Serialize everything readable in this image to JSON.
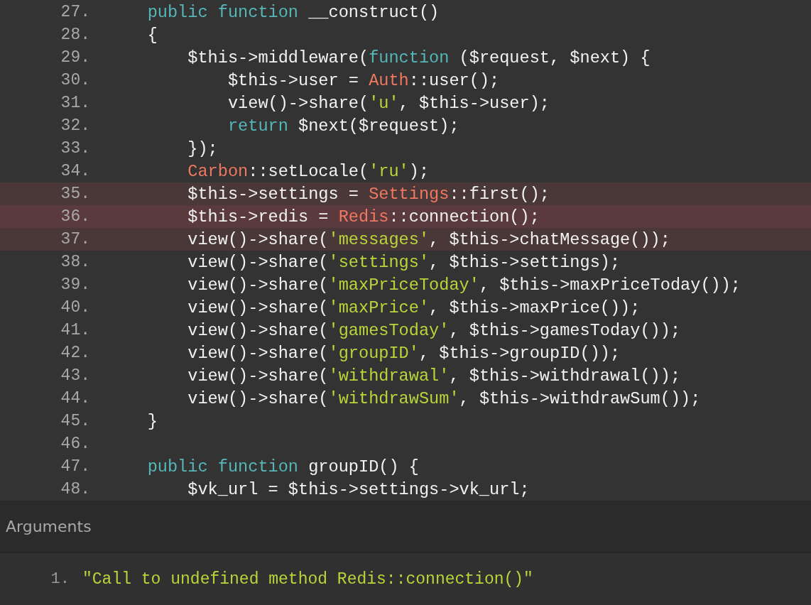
{
  "code_frame": {
    "lines": [
      {
        "number": "27.",
        "highlighted": false,
        "error": false,
        "tokens": [
          {
            "kind": "keyword",
            "text": "    public function"
          },
          {
            "kind": "plain",
            "text": " __construct()"
          }
        ]
      },
      {
        "number": "28.",
        "highlighted": false,
        "error": false,
        "tokens": [
          {
            "kind": "plain",
            "text": "    {"
          }
        ]
      },
      {
        "number": "29.",
        "highlighted": false,
        "error": false,
        "tokens": [
          {
            "kind": "plain",
            "text": "        $this->middleware("
          },
          {
            "kind": "keyword",
            "text": "function"
          },
          {
            "kind": "plain",
            "text": " ($request, $next) {"
          }
        ]
      },
      {
        "number": "30.",
        "highlighted": false,
        "error": false,
        "tokens": [
          {
            "kind": "plain",
            "text": "            $this->user = "
          },
          {
            "kind": "class",
            "text": "Auth"
          },
          {
            "kind": "plain",
            "text": "::user();"
          }
        ]
      },
      {
        "number": "31.",
        "highlighted": false,
        "error": false,
        "tokens": [
          {
            "kind": "plain",
            "text": "            view()->share("
          },
          {
            "kind": "string",
            "text": "'u'"
          },
          {
            "kind": "plain",
            "text": ", $this->user);"
          }
        ]
      },
      {
        "number": "32.",
        "highlighted": false,
        "error": false,
        "tokens": [
          {
            "kind": "keyword",
            "text": "            return"
          },
          {
            "kind": "plain",
            "text": " $next($request);"
          }
        ]
      },
      {
        "number": "33.",
        "highlighted": false,
        "error": false,
        "tokens": [
          {
            "kind": "plain",
            "text": "        });"
          }
        ]
      },
      {
        "number": "34.",
        "highlighted": false,
        "error": false,
        "tokens": [
          {
            "kind": "class",
            "text": "        Carbon"
          },
          {
            "kind": "plain",
            "text": "::setLocale("
          },
          {
            "kind": "string",
            "text": "'ru'"
          },
          {
            "kind": "plain",
            "text": ");"
          }
        ]
      },
      {
        "number": "35.",
        "highlighted": true,
        "error": false,
        "tokens": [
          {
            "kind": "plain",
            "text": "        $this->settings = "
          },
          {
            "kind": "class",
            "text": "Settings"
          },
          {
            "kind": "plain",
            "text": "::first();"
          }
        ]
      },
      {
        "number": "36.",
        "highlighted": true,
        "error": true,
        "tokens": [
          {
            "kind": "plain",
            "text": "        $this->redis = "
          },
          {
            "kind": "class",
            "text": "Redis"
          },
          {
            "kind": "plain",
            "text": "::connection();"
          }
        ]
      },
      {
        "number": "37.",
        "highlighted": true,
        "error": false,
        "tokens": [
          {
            "kind": "plain",
            "text": "        view()->share("
          },
          {
            "kind": "string",
            "text": "'messages'"
          },
          {
            "kind": "plain",
            "text": ", $this->chatMessage());"
          }
        ]
      },
      {
        "number": "38.",
        "highlighted": false,
        "error": false,
        "tokens": [
          {
            "kind": "plain",
            "text": "        view()->share("
          },
          {
            "kind": "string",
            "text": "'settings'"
          },
          {
            "kind": "plain",
            "text": ", $this->settings);"
          }
        ]
      },
      {
        "number": "39.",
        "highlighted": false,
        "error": false,
        "tokens": [
          {
            "kind": "plain",
            "text": "        view()->share("
          },
          {
            "kind": "string",
            "text": "'maxPriceToday'"
          },
          {
            "kind": "plain",
            "text": ", $this->maxPriceToday());"
          }
        ]
      },
      {
        "number": "40.",
        "highlighted": false,
        "error": false,
        "tokens": [
          {
            "kind": "plain",
            "text": "        view()->share("
          },
          {
            "kind": "string",
            "text": "'maxPrice'"
          },
          {
            "kind": "plain",
            "text": ", $this->maxPrice());"
          }
        ]
      },
      {
        "number": "41.",
        "highlighted": false,
        "error": false,
        "tokens": [
          {
            "kind": "plain",
            "text": "        view()->share("
          },
          {
            "kind": "string",
            "text": "'gamesToday'"
          },
          {
            "kind": "plain",
            "text": ", $this->gamesToday());"
          }
        ]
      },
      {
        "number": "42.",
        "highlighted": false,
        "error": false,
        "tokens": [
          {
            "kind": "plain",
            "text": "        view()->share("
          },
          {
            "kind": "string",
            "text": "'groupID'"
          },
          {
            "kind": "plain",
            "text": ", $this->groupID());"
          }
        ]
      },
      {
        "number": "43.",
        "highlighted": false,
        "error": false,
        "tokens": [
          {
            "kind": "plain",
            "text": "        view()->share("
          },
          {
            "kind": "string",
            "text": "'withdrawal'"
          },
          {
            "kind": "plain",
            "text": ", $this->withdrawal());"
          }
        ]
      },
      {
        "number": "44.",
        "highlighted": false,
        "error": false,
        "tokens": [
          {
            "kind": "plain",
            "text": "        view()->share("
          },
          {
            "kind": "string",
            "text": "'withdrawSum'"
          },
          {
            "kind": "plain",
            "text": ", $this->withdrawSum());"
          }
        ]
      },
      {
        "number": "45.",
        "highlighted": false,
        "error": false,
        "tokens": [
          {
            "kind": "plain",
            "text": "    }"
          }
        ]
      },
      {
        "number": "46.",
        "highlighted": false,
        "error": false
      },
      {
        "number": "47.",
        "highlighted": false,
        "error": false,
        "tokens": [
          {
            "kind": "keyword",
            "text": "    public function"
          },
          {
            "kind": "plain",
            "text": " groupID() {"
          }
        ]
      },
      {
        "number": "48.",
        "highlighted": false,
        "error": false,
        "tokens": [
          {
            "kind": "plain",
            "text": "        $vk_url = $this->settings->vk_url;"
          }
        ]
      }
    ]
  },
  "arguments": {
    "title": "Arguments",
    "items": [
      {
        "number": "1.",
        "value": "\"Call to undefined method Redis::connection()\""
      }
    ]
  }
}
